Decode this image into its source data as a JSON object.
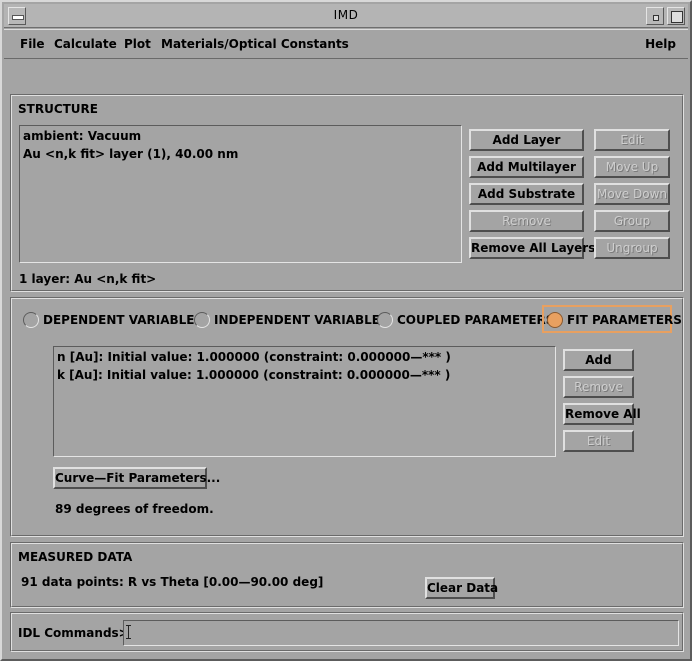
{
  "window": {
    "title": "IMD"
  },
  "menu": {
    "file": "File",
    "calculate": "Calculate",
    "plot": "Plot",
    "materials": "Materials/Optical Constants",
    "help": "Help"
  },
  "structure": {
    "heading": "STRUCTURE",
    "layers": [
      "ambient: Vacuum",
      "Au <n,k fit> layer (1), 40.00 nm"
    ],
    "summary": "1 layer: Au <n,k fit>",
    "buttons": {
      "add_layer": "Add Layer",
      "add_multilayer": "Add Multilayer",
      "add_substrate": "Add Substrate",
      "remove": "Remove",
      "remove_all_layers": "Remove All Layers",
      "edit": "Edit",
      "move_up": "Move Up",
      "move_down": "Move Down",
      "group": "Group",
      "ungroup": "Ungroup"
    }
  },
  "parameters": {
    "radios": {
      "dependent": "DEPENDENT VARIABLES",
      "independent": "INDEPENDENT VARIABLES",
      "coupled": "COUPLED PARAMETERS",
      "fit": "FIT PARAMETERS"
    },
    "selected": "fit",
    "fit_list": [
      "n [Au]: Initial value: 1.000000  (constraint: 0.000000—*** )",
      "k [Au]: Initial value: 1.000000  (constraint: 0.000000—*** )"
    ],
    "buttons": {
      "add": "Add",
      "remove": "Remove",
      "remove_all": "Remove All",
      "edit": "Edit",
      "curve_fit": "Curve—Fit Parameters..."
    },
    "dof_text": "89 degrees of freedom."
  },
  "measured": {
    "heading": "MEASURED DATA",
    "info": "91 data points: R vs Theta [0.00—90.00 deg]",
    "clear_button": "Clear Data"
  },
  "idl": {
    "label": "IDL Commands>",
    "value": ""
  },
  "colors": {
    "background": "#a4a4a4",
    "selected_accent": "#e8a060"
  }
}
